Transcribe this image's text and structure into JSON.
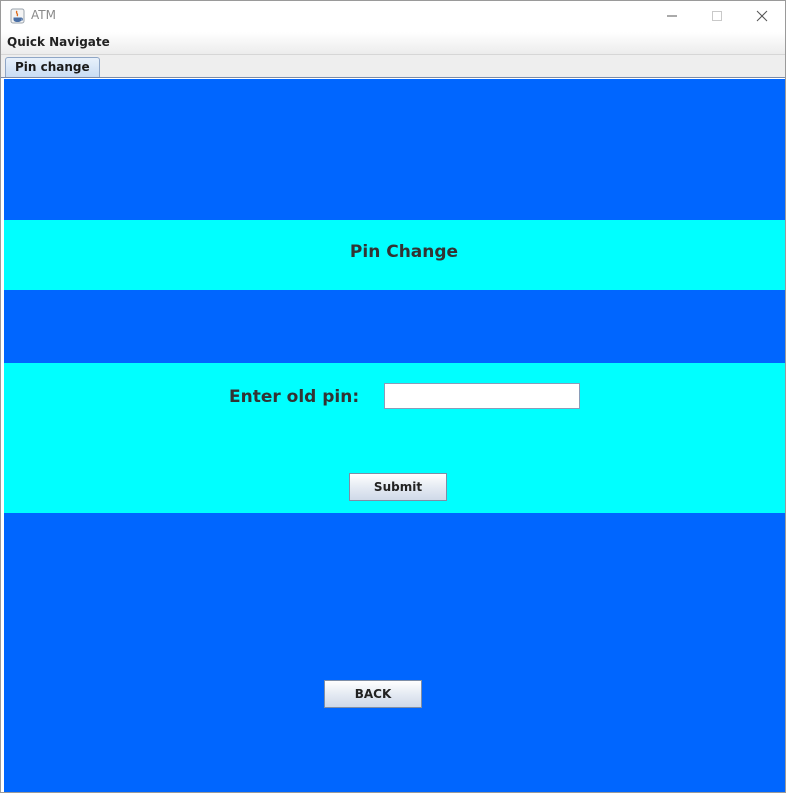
{
  "window": {
    "title": "ATM",
    "icons": {
      "app": "java-cup-icon",
      "minimize": "minimize-icon",
      "maximize": "maximize-icon",
      "close": "close-icon"
    }
  },
  "menubar": {
    "items": [
      {
        "label": "Quick Navigate"
      }
    ]
  },
  "tabs": [
    {
      "label": "Pin change",
      "selected": true
    }
  ],
  "pin_change": {
    "heading": "Pin Change",
    "old_pin_label": "Enter old pin:",
    "old_pin_value": "",
    "submit_label": "Submit",
    "back_label": "BACK"
  },
  "colors": {
    "background_blue": "#0066ff",
    "band_cyan": "#00ffff",
    "text_dark": "#333333"
  }
}
